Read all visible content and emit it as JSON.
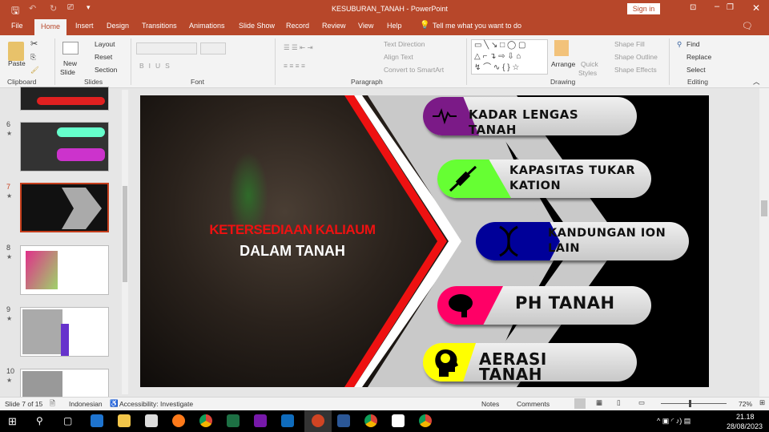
{
  "window": {
    "title": "KESUBURAN_TANAH - PowerPoint",
    "sign_in": "Sign in"
  },
  "tabs": [
    "File",
    "Home",
    "Insert",
    "Design",
    "Transitions",
    "Animations",
    "Slide Show",
    "Record",
    "Review",
    "View",
    "Help"
  ],
  "tell_me": "Tell me what you want to do",
  "ribbon": {
    "clipboard": {
      "paste": "Paste",
      "group": "Clipboard"
    },
    "slides": {
      "new_slide": "New",
      "new_slide2": "Slide",
      "layout": "Layout",
      "reset": "Reset",
      "section": "Section",
      "group": "Slides"
    },
    "font": {
      "group": "Font"
    },
    "paragraph": {
      "text_direction": "Text Direction",
      "align_text": "Align Text",
      "convert": "Convert to SmartArt",
      "group": "Paragraph"
    },
    "drawing": {
      "arrange": "Arrange",
      "quick": "Quick",
      "styles": "Styles",
      "shape_fill": "Shape Fill",
      "shape_outline": "Shape Outline",
      "shape_effects": "Shape Effects",
      "group": "Drawing"
    },
    "editing": {
      "find": "Find",
      "replace": "Replace",
      "select": "Select",
      "group": "Editing"
    }
  },
  "thumbnails": [
    {
      "num": "6"
    },
    {
      "num": "7"
    },
    {
      "num": "8"
    },
    {
      "num": "9"
    },
    {
      "num": "10"
    }
  ],
  "slide": {
    "title_red": "KETERSEDIAAN KALIAUM",
    "title_white": "DALAM TANAH",
    "items": [
      {
        "label": "KADAR LENGAS TANAH",
        "icon": "heartbeat-icon",
        "color": "#7b1a87"
      },
      {
        "label": "KAPASITAS TUKAR KATION",
        "icon": "syringe-icon",
        "color": "#66ff33"
      },
      {
        "label": "KANDUNGAN ION LAIN",
        "icon": "dna-icon",
        "color": "#000099"
      },
      {
        "label": "PH TANAH",
        "icon": "brain-icon",
        "color": "#ff0066"
      },
      {
        "label": "AERASI TANAH",
        "icon": "head-brain-icon",
        "color": "#ffff00"
      }
    ]
  },
  "status": {
    "slide": "Slide 7 of 15",
    "language": "Indonesian",
    "accessibility": "Accessibility: Investigate",
    "notes": "Notes",
    "comments": "Comments",
    "zoom": "72%"
  },
  "clock": {
    "time": "21.18",
    "date": "28/08/2023"
  }
}
